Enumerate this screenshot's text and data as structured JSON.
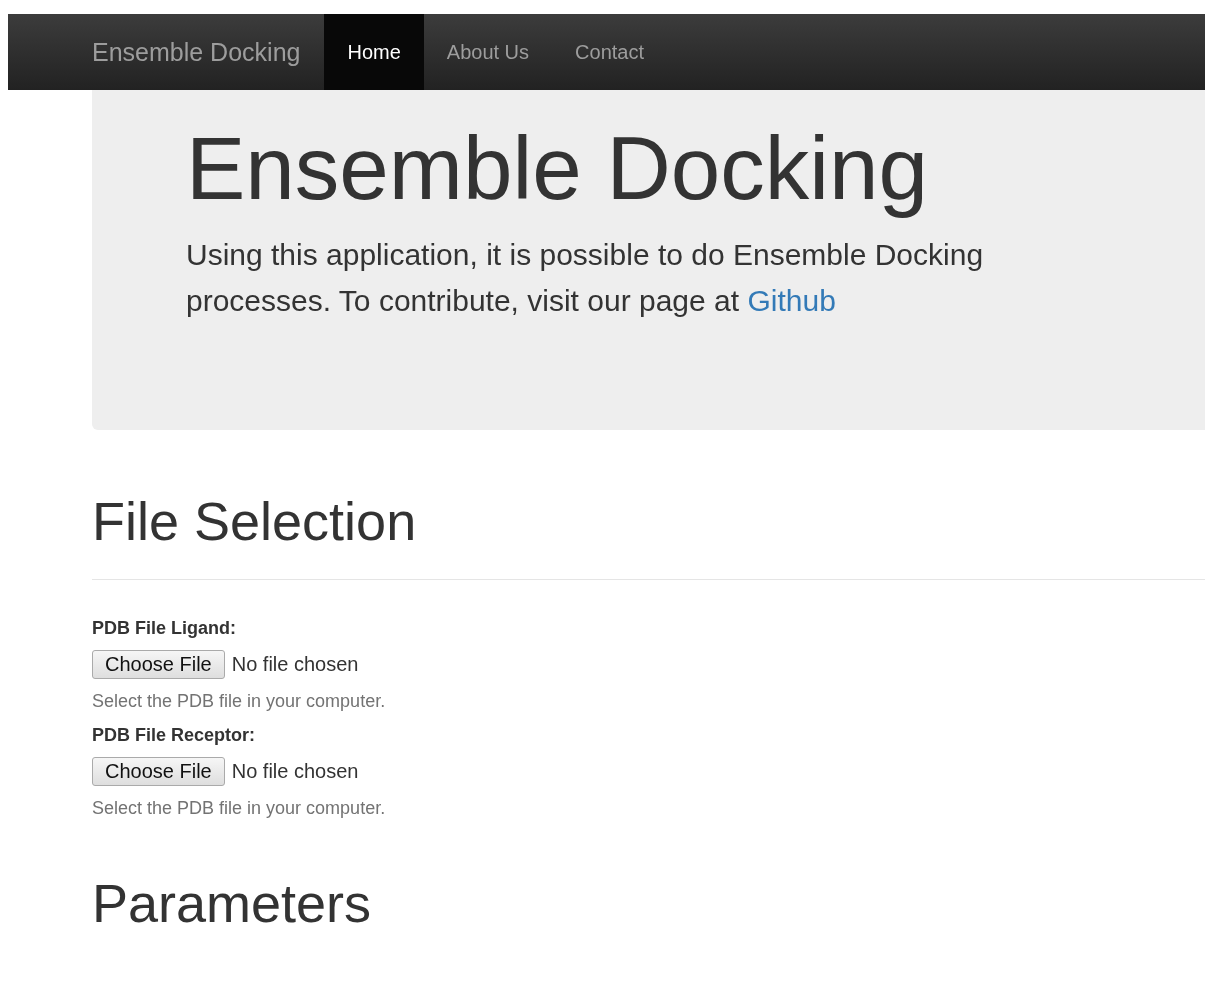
{
  "navbar": {
    "brand": "Ensemble Docking",
    "items": [
      {
        "label": "Home",
        "selected": true
      },
      {
        "label": "About Us",
        "selected": false
      },
      {
        "label": "Contact",
        "selected": false
      }
    ]
  },
  "jumbotron": {
    "title": "Ensemble Docking",
    "text": "Using this application, it is possible to do Ensemble Docking processes. To contribute, visit our page at ",
    "link": "Github"
  },
  "file_selection": {
    "heading": "File Selection",
    "fields": [
      {
        "label": "PDB File Ligand:",
        "button": "Choose File",
        "status": "No file chosen",
        "help": "Select the PDB file in your computer."
      },
      {
        "label": "PDB File Receptor:",
        "button": "Choose File",
        "status": "No file chosen",
        "help": "Select the PDB file in your computer."
      }
    ]
  },
  "parameters": {
    "heading": "Parameters"
  }
}
